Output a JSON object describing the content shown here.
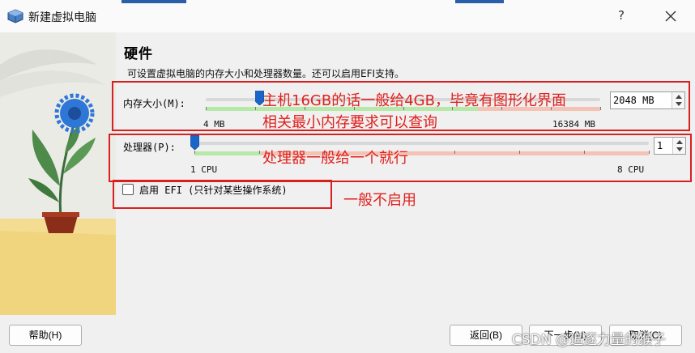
{
  "window": {
    "title": "新建虚拟电脑",
    "help": "?"
  },
  "page": {
    "heading": "硬件",
    "description": "可设置虚拟电脑的内存大小和处理器数量。还可以启用EFI支持。"
  },
  "memory": {
    "label": "内存大小(M):",
    "min_label": "4 MB",
    "max_label": "16384 MB",
    "value": "2048 MB",
    "current_mb": 2048,
    "max_mb": 16384
  },
  "processor": {
    "label": "处理器(P):",
    "min_label": "1 CPU",
    "max_label": "8 CPU",
    "value": "1",
    "current": 1,
    "max": 8
  },
  "efi": {
    "label": "启用 EFI (只针对某些操作系统)",
    "checked": false
  },
  "annotations": {
    "memory_line1": "主机16GB的话一般给4GB，毕竟有图形化界面",
    "memory_line2": "相关最小内存要求可以查询",
    "processor": "处理器一般给一个就行",
    "efi": "一般不启用"
  },
  "buttons": {
    "help": "帮助(H)",
    "back": "返回(B)",
    "next": "下一步(N)",
    "cancel": "取消(C)"
  },
  "watermark": "CSDN @追逐力量的猴子",
  "colors": {
    "annotation_red": "#d92020",
    "handle_blue": "#1a66c8",
    "slider_green": "#b6e8a8",
    "slider_red": "#f5c2b6"
  }
}
